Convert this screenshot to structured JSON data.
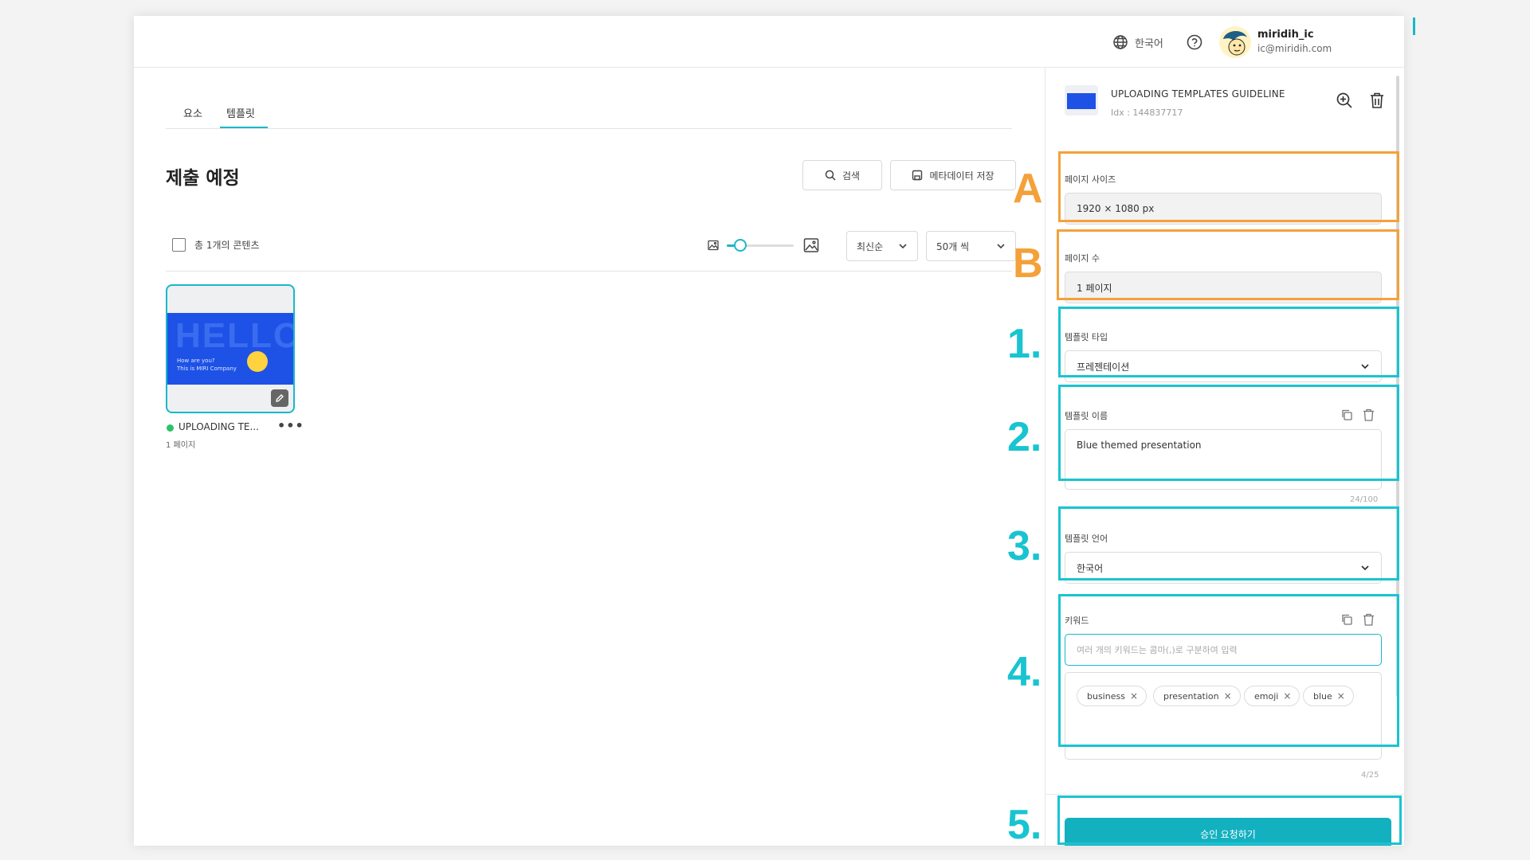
{
  "header": {
    "language": "한국어",
    "user": {
      "name": "miridih_ic",
      "email": "ic@miridih.com"
    }
  },
  "tabs": [
    {
      "label": "요소"
    },
    {
      "label": "템플릿"
    }
  ],
  "main": {
    "title": "제출 예정",
    "search_label": "검색",
    "save_metadata_label": "메타데이터 저장",
    "total_label": "총 1개의 콘텐츠",
    "sort": {
      "selected": "최신순"
    },
    "per_page": {
      "selected": "50개 씩"
    },
    "thumb_size_level": 0.2,
    "card": {
      "name": "UPLOADING TE...",
      "pages": "1 페이지",
      "thumb": {
        "hello": "HELLO",
        "line1": "How are you?",
        "line2": "This is MIRI Company"
      }
    }
  },
  "panel": {
    "template_title": "UPLOADING TEMPLATES GUIDELINE",
    "template_idx": "Idx : 144837717",
    "page_size": {
      "label": "페이지 사이즈",
      "value": "1920 × 1080 px"
    },
    "page_count": {
      "label": "페이지 수",
      "value": "1 페이지"
    },
    "template_type": {
      "label": "템플릿 타입",
      "value": "프레젠테이션"
    },
    "template_name": {
      "label": "템플릿 이름",
      "value": "Blue themed presentation",
      "counter": "24/100"
    },
    "template_language": {
      "label": "템플릿 언어",
      "value": "한국어"
    },
    "keywords": {
      "label": "키워드",
      "placeholder": "여러 개의 키워드는 콤마(,)로 구분하여 입력",
      "chips": [
        "business",
        "presentation",
        "emoji",
        "blue"
      ],
      "counter": "4/25"
    },
    "submit_label": "승인 요청하기"
  },
  "annotations": {
    "colors": {
      "orange": "#f4a13a",
      "cyan": "#19c4d1",
      "accent": "#13b0c0"
    },
    "labels": [
      "A",
      "B",
      "1.",
      "2.",
      "3.",
      "4.",
      "5."
    ]
  }
}
